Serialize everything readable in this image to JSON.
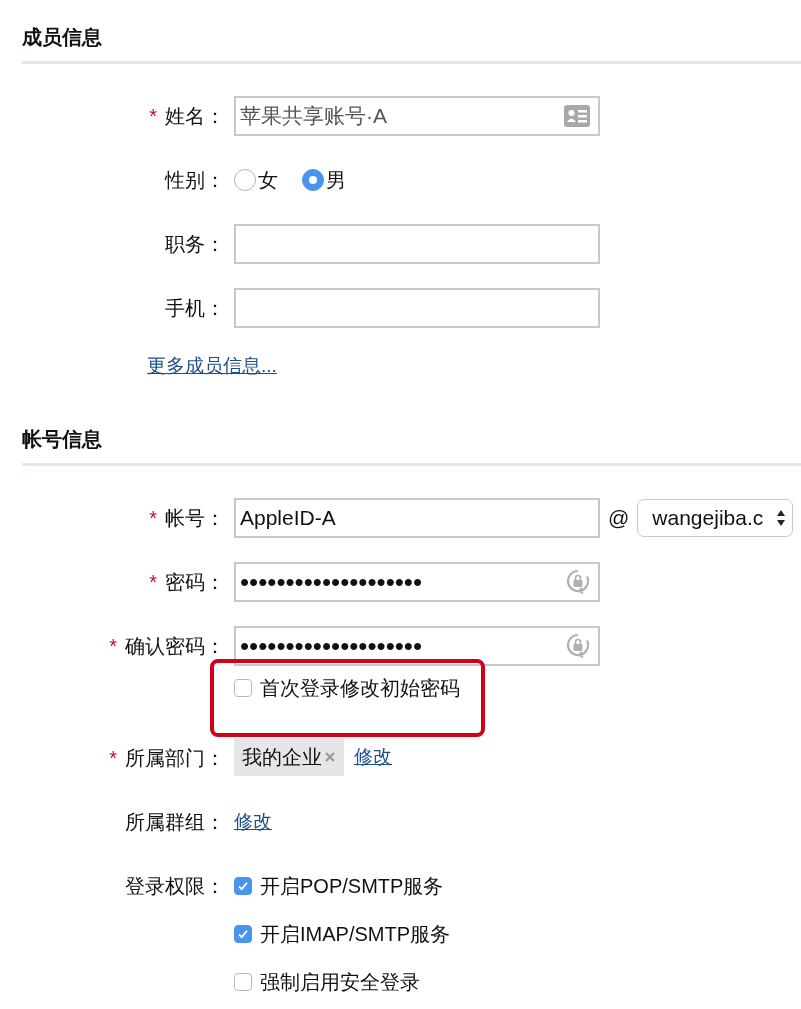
{
  "sections": [
    {
      "title": "成员信息",
      "rows": [
        {
          "kind": "name",
          "label": "姓名：",
          "mark": "*",
          "value": "苹果共享账号·A"
        },
        {
          "kind": "radio",
          "label": "性别：",
          "options": [
            {
              "label": "女",
              "selected": false
            },
            {
              "label": "男",
              "selected": true
            }
          ]
        },
        {
          "kind": "text",
          "label": "职务："
        },
        {
          "kind": "text",
          "label": "手机："
        },
        {
          "kind": "link",
          "link": "更多成员信息..."
        }
      ]
    },
    {
      "title": "帐号信息",
      "rows": [
        {
          "kind": "account",
          "label": "帐号：",
          "mark": "*",
          "value": "AppleID-A",
          "at": "@",
          "domain": "wangejiba.c"
        },
        {
          "kind": "password",
          "label": "密码：",
          "mark": "*",
          "value": "••••••••••••••••••••"
        },
        {
          "kind": "password",
          "label": "确认密码：",
          "mark": "*",
          "value": "••••••••••••••••••••"
        },
        {
          "kind": "checks",
          "options": [
            {
              "label": "首次登录修改初始密码",
              "checked": false
            }
          ]
        },
        {
          "kind": "department",
          "label": "所属部门：",
          "mark": "*",
          "tag": "我的企业",
          "link": "修改"
        },
        {
          "kind": "group",
          "label": "所属群组：",
          "link": "修改"
        },
        {
          "kind": "checks",
          "label": "登录权限：",
          "options": [
            {
              "label": "开启POP/SMTP服务",
              "checked": true
            },
            {
              "label": "开启IMAP/SMTP服务",
              "checked": true
            },
            {
              "label": "强制启用安全登录",
              "checked": false
            }
          ]
        }
      ]
    }
  ]
}
